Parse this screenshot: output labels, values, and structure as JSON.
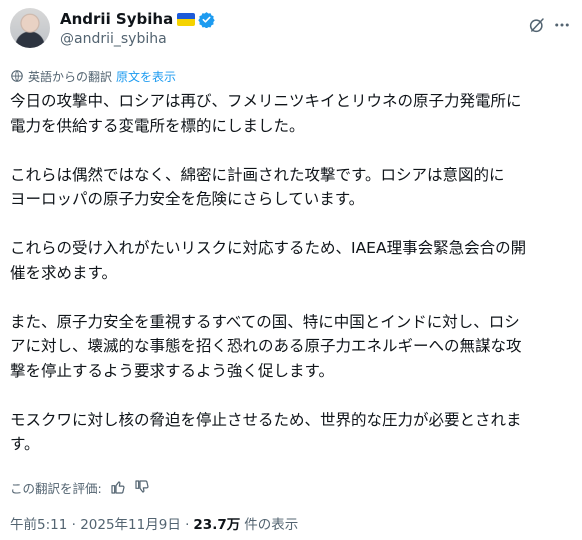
{
  "author": {
    "display_name": "Andrii Sybiha",
    "handle": "@andrii_sybiha",
    "flag": "ukraine-flag-icon",
    "verified": true
  },
  "icons": {
    "grok": "grok-icon",
    "more": "more-icon",
    "translate": "translate-icon",
    "thumbs_up": "thumbs-up-icon",
    "thumbs_down": "thumbs-down-icon"
  },
  "translation": {
    "label": "英語からの翻訳",
    "show_original": "原文を表示"
  },
  "body": {
    "paragraphs": [
      "今日の攻撃中、ロシアは再び、フメリニツキイとリウネの原子力発電所に\n電力を供給する変電所を標的にしました。",
      "これらは偶然ではなく、綿密に計画された攻撃です。ロシアは意図的に\nヨーロッパの原子力安全を危険にさらしています。",
      "これらの受け入れがたいリスクに対応するため、IAEA理事会緊急会合の開\n催を求めます。",
      "また、原子力安全を重視するすべての国、特に中国とインドに対し、ロシ\nアに対し、壊滅的な事態を招く恐れのある原子力エネルギーへの無謀な攻\n撃を停止するよう要求するよう強く促します。",
      "モスクワに対し核の脅迫を停止させるため、世界的な圧力が必要とされま\nす。"
    ]
  },
  "rating": {
    "label": "この翻訳を評価:"
  },
  "meta": {
    "timestamp": "午前5:11 · 2025年11月9日 ·",
    "views_count": "23.7万",
    "views_label": "件の表示"
  },
  "colors": {
    "text": "#0f1419",
    "secondary": "#536471",
    "link": "#1d9bf0",
    "verified": "#1d9bf0"
  }
}
